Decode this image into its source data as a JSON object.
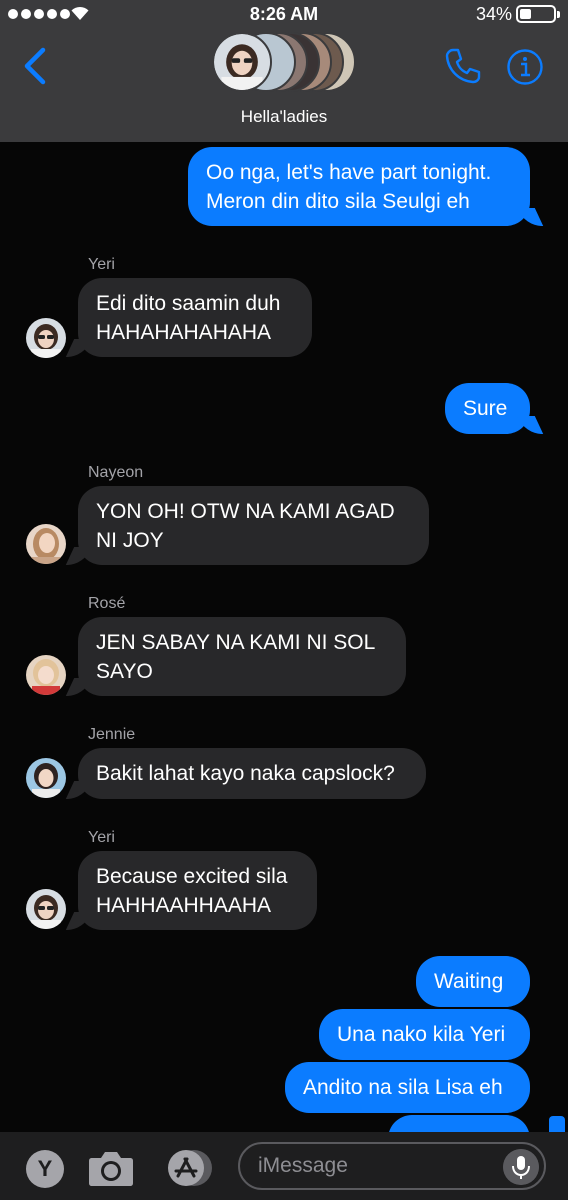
{
  "status_bar": {
    "time": "8:26 AM",
    "battery_percent": "34%",
    "battery_level": 0.34,
    "signal_bars": 5
  },
  "header": {
    "group_name": "Hella'ladies"
  },
  "colors": {
    "header_bg": "#3b3b3d",
    "thread_bg": "#060606",
    "incoming_bubble": "#28282a",
    "outgoing_bubble": "#0b7cff",
    "sender_name": "#a3a3a8"
  },
  "messages": [
    {
      "direction": "outgoing",
      "text_lines": [
        "Oo nga, let's have part tonight.",
        "Meron din dito sila Seulgi eh"
      ]
    },
    {
      "direction": "incoming",
      "sender": "Yeri",
      "text_lines": [
        "Edi dito saamin duh",
        "HAHAHAHAHAHA"
      ]
    },
    {
      "direction": "outgoing",
      "text_lines": [
        "Sure"
      ]
    },
    {
      "direction": "incoming",
      "sender": "Nayeon",
      "text_lines": [
        "YON OH! OTW NA KAMI AGAD",
        "NI JOY"
      ]
    },
    {
      "direction": "incoming",
      "sender": "Rosé",
      "text_lines": [
        "JEN SABAY NA KAMI NI SOL",
        "SAYO"
      ]
    },
    {
      "direction": "incoming",
      "sender": "Jennie",
      "text_lines": [
        "Bakit lahat kayo naka capslock?"
      ]
    },
    {
      "direction": "incoming",
      "sender": "Yeri",
      "text_lines": [
        "Because excited sila",
        "HAHHAAHHAAHA"
      ]
    },
    {
      "direction": "outgoing",
      "text_lines": [
        "Waiting"
      ]
    },
    {
      "direction": "outgoing",
      "text_lines": [
        "Una nako kila Yeri"
      ]
    },
    {
      "direction": "outgoing",
      "text_lines": [
        "Andito na sila Lisa eh"
      ]
    }
  ],
  "input_bar": {
    "app_label": "Y",
    "placeholder": "iMessage"
  },
  "icons": [
    "back-icon",
    "phone-icon",
    "info-icon",
    "camera-icon",
    "app-store-icon",
    "microphone-icon"
  ]
}
